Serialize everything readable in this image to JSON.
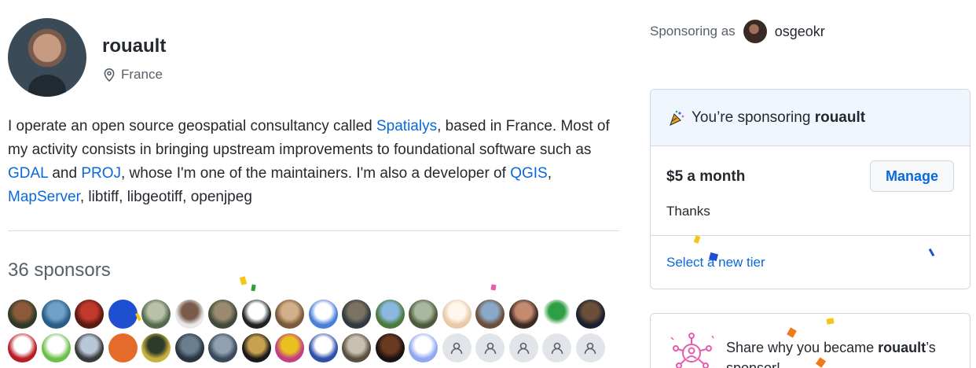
{
  "profile": {
    "username": "rouault",
    "location": "France",
    "bio": {
      "t1": "I operate an open source geospatial consultancy called ",
      "link1": "Spatialys",
      "t2": ", based in France. Most of my activity consists in bringing upstream improvements to foundational software such as ",
      "link2": "GDAL",
      "t3": " and ",
      "link3": "PROJ",
      "t4": ", whose I'm one of the maintainers. I'm also a developer of ",
      "link4": "QGIS",
      "t5": ", ",
      "link5": "MapServer",
      "t6": ", libtiff, libgeotiff, openjpeg"
    }
  },
  "sponsors": {
    "title": "36 sponsors",
    "avatars": [
      {
        "c1": "#8a5a3a",
        "c2": "#2d3a2a"
      },
      {
        "c1": "#6fa0c8",
        "c2": "#2a5d86"
      },
      {
        "c1": "#c0392b",
        "c2": "#5a1a12"
      },
      {
        "c1": "#1e4fd0",
        "c2": "#1e4fd0"
      },
      {
        "c1": "#b9c2a8",
        "c2": "#556b4e"
      },
      {
        "c1": "#7a5c4a",
        "c2": "#e8e8e8"
      },
      {
        "c1": "#9c8a70",
        "c2": "#3f4a3a"
      },
      {
        "c1": "#ffffff",
        "c2": "#222222"
      },
      {
        "c1": "#d4b08a",
        "c2": "#7a5a3a"
      },
      {
        "c1": "#ffffff",
        "c2": "#4a7ed8"
      },
      {
        "c1": "#7b7262",
        "c2": "#2e3a40"
      },
      {
        "c1": "#8bb8e0",
        "c2": "#4b7a3a"
      },
      {
        "c1": "#a9b8a0",
        "c2": "#4e5a3e"
      },
      {
        "c1": "#fff7ee",
        "c2": "#e8c9a8"
      },
      {
        "c1": "#8aa8c8",
        "c2": "#6b4f3a"
      },
      {
        "c1": "#c38a70",
        "c2": "#3a2a24"
      },
      {
        "c1": "#2ea043",
        "c2": "#ffffff"
      },
      {
        "c1": "#6b4f3a",
        "c2": "#1a1f2e"
      },
      {
        "c1": "#ffffff",
        "c2": "#b81d24"
      },
      {
        "c1": "#ffffff",
        "c2": "#6cc04a"
      },
      {
        "c1": "#b8c8d8",
        "c2": "#3a3a3a"
      },
      {
        "c1": "#e56b2a",
        "c2": "#e56b2a"
      },
      {
        "c1": "#2e3a2a",
        "c2": "#c8b040"
      },
      {
        "c1": "#6a7e8e",
        "c2": "#2a3440"
      },
      {
        "c1": "#8fa0b0",
        "c2": "#3a4a5a"
      },
      {
        "c1": "#c8a050",
        "c2": "#1a1a1a"
      },
      {
        "c1": "#e8c020",
        "c2": "#c04080"
      },
      {
        "c1": "#ffffff",
        "c2": "#2f4fa8"
      },
      {
        "c1": "#c8c0b0",
        "c2": "#5a5040"
      },
      {
        "c1": "#6a3a20",
        "c2": "#1a1210"
      },
      {
        "c1": "#ffffff",
        "c2": "#8fa8f0"
      },
      {
        "ghost": true
      },
      {
        "ghost": true
      },
      {
        "ghost": true
      },
      {
        "ghost": true
      },
      {
        "ghost": true
      }
    ]
  },
  "sidebar": {
    "sponsoring_as_label": "Sponsoring as",
    "sponsoring_as_user": "osgeokr",
    "card": {
      "prefix": "You’re sponsoring ",
      "user": "rouault",
      "tier": "$5 a month",
      "note": "Thanks",
      "manage_label": "Manage",
      "select_tier_label": "Select a new tier"
    },
    "share": {
      "prefix": "Share why you became ",
      "user": "rouault",
      "suffix": "’s sponsor!"
    }
  },
  "colors": {
    "link": "#0969da",
    "card_header_bg": "#f0f6fd",
    "ghost_avatar_bg": "#e1e4e8",
    "share_illustration": "#e85aad"
  },
  "icons": [
    "location-pin-icon",
    "party-popper-icon",
    "person-icon",
    "share-illustration-icon"
  ]
}
